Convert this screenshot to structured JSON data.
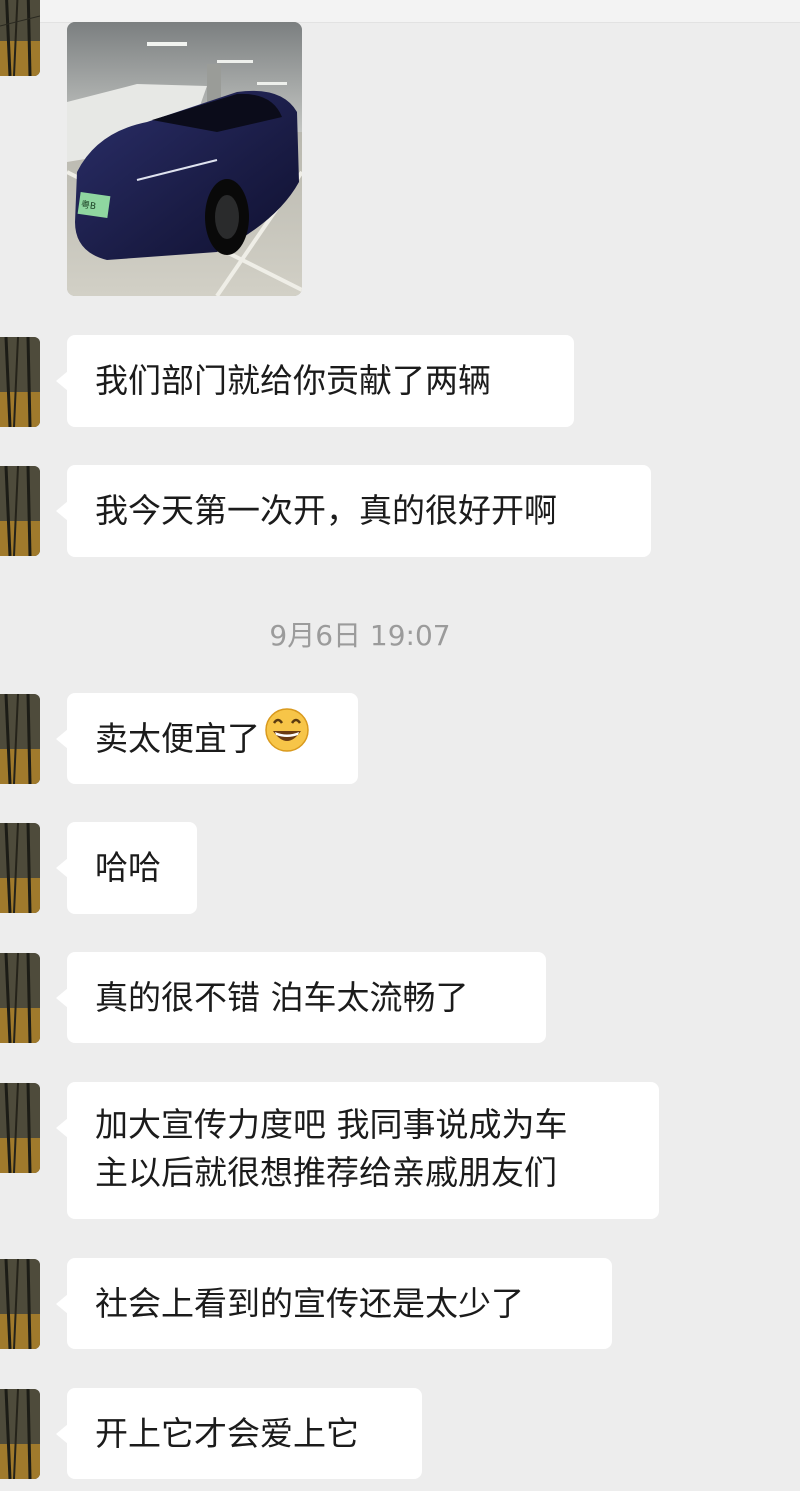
{
  "chat": {
    "timestamp": "9月6日 19:07",
    "image_message": {
      "icon": "car-photo",
      "plate_text": "粤B"
    },
    "messages": [
      {
        "text": "我们部门就给你贡献了两辆"
      },
      {
        "text": "我今天第一次开，真的很好开啊"
      },
      {
        "text": "卖太便宜了",
        "emoji": "grinning-face-icon"
      },
      {
        "text": "哈哈"
      },
      {
        "text": "真的很不错 泊车太流畅了"
      },
      {
        "lines": [
          "加大宣传力度吧 我同事说成为车",
          "主以后就很想推荐给亲戚朋友们"
        ]
      },
      {
        "text": "社会上看到的宣传还是太少了"
      },
      {
        "text": "开上它才会爱上它"
      }
    ]
  },
  "colors": {
    "background": "#ededed",
    "bubble": "#ffffff",
    "text": "#1b1b1b",
    "timestamp": "#9b9b9b",
    "emoji_face": "#f7c548"
  }
}
